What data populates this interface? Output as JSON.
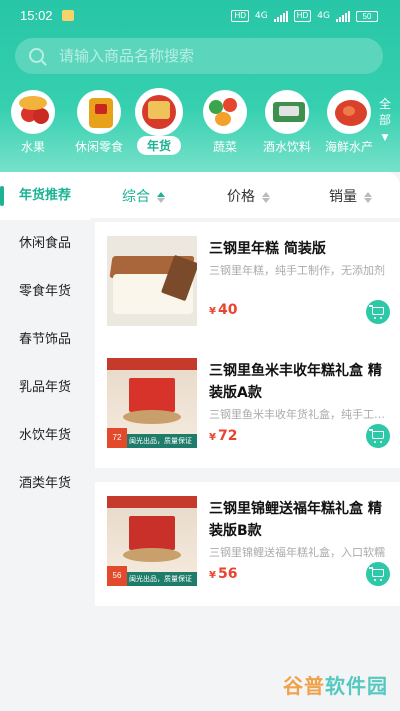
{
  "status": {
    "time": "15:02",
    "network1": "4G",
    "network2": "4G",
    "hd": "HD",
    "battery": "50"
  },
  "search": {
    "placeholder": "请输入商品名称搜索"
  },
  "categories": [
    {
      "label": "水果",
      "icon": "fruit-icon"
    },
    {
      "label": "休闲零食",
      "icon": "snack-icon"
    },
    {
      "label": "年货",
      "icon": "newyear-goods-icon",
      "active": true
    },
    {
      "label": "蔬菜",
      "icon": "vegetable-icon"
    },
    {
      "label": "酒水饮料",
      "icon": "drinks-icon"
    },
    {
      "label": "海鲜水产",
      "icon": "seafood-icon"
    }
  ],
  "all_button": {
    "label1": "全",
    "label2": "部",
    "icon": "chevron-down-icon"
  },
  "sidebar": {
    "items": [
      {
        "label": "年货推荐",
        "active": true
      },
      {
        "label": "休闲食品"
      },
      {
        "label": "零食年货"
      },
      {
        "label": "春节饰品"
      },
      {
        "label": "乳品年货"
      },
      {
        "label": "水饮年货"
      },
      {
        "label": "酒类年货"
      }
    ]
  },
  "sort": {
    "comprehensive": "综合",
    "price": "价格",
    "sales": "销量"
  },
  "products": [
    {
      "title": "三钢里年糕 简装版",
      "desc": "三钢里年糕，纯手工制作，无添加剂",
      "currency": "¥",
      "price": "40"
    },
    {
      "title": "三钢里鱼米丰收年糕礼盒 精装版A款",
      "desc": "三钢里鱼米丰收年货礼盒，纯手工制作",
      "currency": "¥",
      "price": "72",
      "badge_price": "72",
      "badge_text": "闽光出品，质量保证"
    },
    {
      "title": "三钢里锦鲤送福年糕礼盒 精装版B款",
      "desc": "三钢里锦鲤送福年糕礼盒，入口软糯",
      "currency": "¥",
      "price": "56",
      "badge_price": "56",
      "badge_text": "闽光出品，质量保证"
    }
  ],
  "watermark": {
    "part1": "谷普",
    "part2": "软件园"
  },
  "colors": {
    "accent": "#1bb394",
    "price": "#e8442e",
    "header": "#27c6a6"
  }
}
